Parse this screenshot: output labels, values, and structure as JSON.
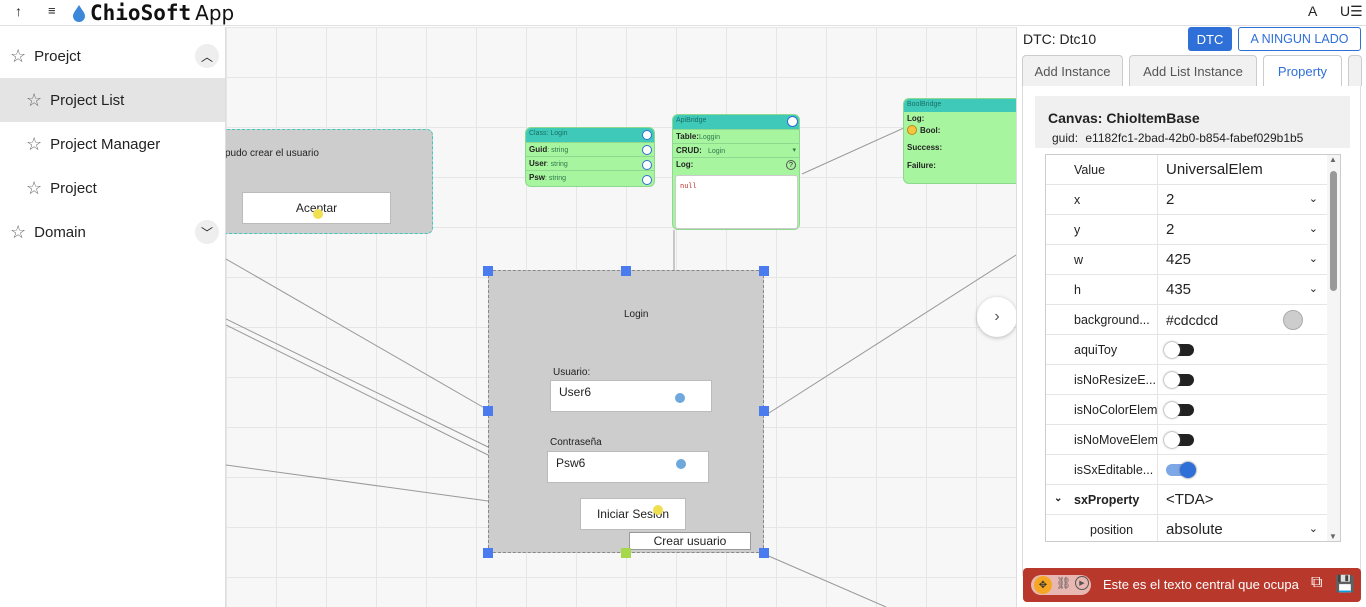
{
  "topbar": {
    "up_icon": "↑",
    "menu_icon": "≡",
    "brand_name": "ChioSoft",
    "brand_app": "App",
    "right_a": "A",
    "right_u": "U☰"
  },
  "sidebar": {
    "items": [
      {
        "label": "Proejct"
      },
      {
        "label": "Project List"
      },
      {
        "label": "Project Manager"
      },
      {
        "label": "Project"
      },
      {
        "label": "Domain"
      }
    ]
  },
  "canvas": {
    "dialog": {
      "message": "pudo crear el usuario",
      "button": "Aceptar"
    },
    "class_node": {
      "title": "Class: Login",
      "rows": [
        {
          "k": "Guid",
          "v": ": string"
        },
        {
          "k": "User",
          "v": ": string"
        },
        {
          "k": "Psw",
          "v": ": string"
        }
      ]
    },
    "api_node": {
      "title": "ApiBridge",
      "table_k": "Table:",
      "table_v": "Loggin",
      "crud_k": "CRUD:",
      "crud_v": "Login",
      "log_k": "Log:",
      "log_v": "null"
    },
    "bool_node": {
      "title": "BoolBridge",
      "log": "Log:",
      "bool": "Bool:",
      "success": "Success:",
      "failure": "Failure:"
    },
    "login": {
      "title": "Login",
      "user_label": "Usuario:",
      "user_value": "User6",
      "pass_label": "Contraseña",
      "pass_value": "Psw6",
      "submit": "Iniciar Sesion",
      "create": "Crear usuario"
    }
  },
  "panel": {
    "dtc_label": "DTC: Dtc10",
    "dtc_btn": "DTC",
    "side_btn": "A NINGUN LADO",
    "tabs": [
      "Add Instance",
      "Add List Instance",
      "Property"
    ],
    "canvas_title": "Canvas: ChioItemBase",
    "guid_label": "guid:",
    "guid_value": "e1182fc1-2bad-42b0-b854-fabef029b1b5",
    "props": [
      {
        "k": "Value",
        "v": "UniversalElem"
      },
      {
        "k": "x",
        "v": "2"
      },
      {
        "k": "y",
        "v": "2"
      },
      {
        "k": "w",
        "v": "425"
      },
      {
        "k": "h",
        "v": "435"
      },
      {
        "k": "background...",
        "v": "#cdcdcd"
      },
      {
        "k": "aquiToy",
        "v": ""
      },
      {
        "k": "isNoResizeE...",
        "v": ""
      },
      {
        "k": "isNoColorElem",
        "v": ""
      },
      {
        "k": "isNoMoveElem",
        "v": ""
      },
      {
        "k": "isSxEditable...",
        "v": ""
      },
      {
        "k": "sxProperty",
        "v": "<TDA>"
      },
      {
        "k": "position",
        "v": "absolute"
      }
    ],
    "footer_text": "Este es el texto central que ocupa"
  },
  "colors": {
    "accent": "#2f6fd8",
    "teal": "#3ec9b9",
    "green": "#a8f5a0",
    "footer": "#b8382b"
  }
}
